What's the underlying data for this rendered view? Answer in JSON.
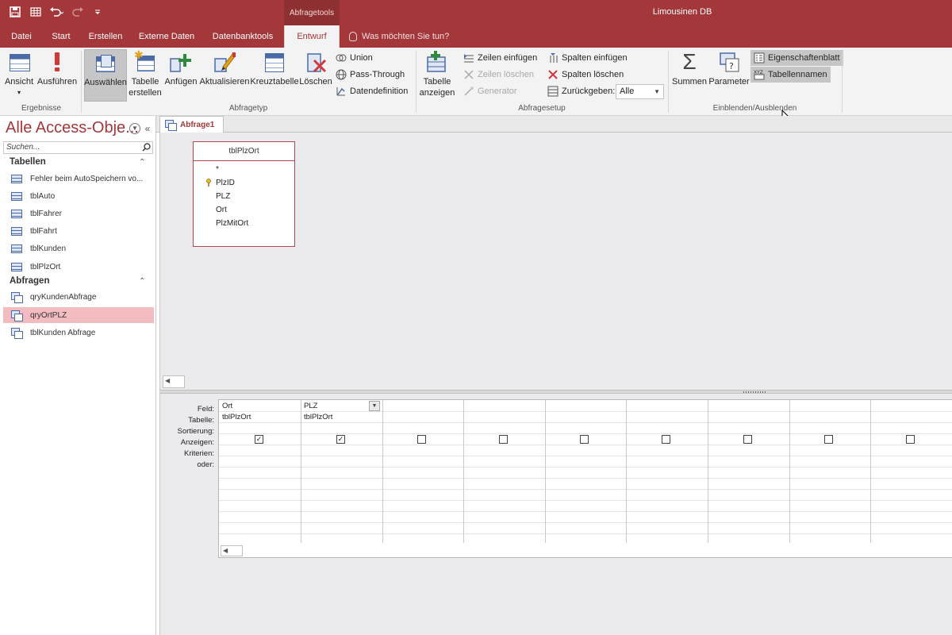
{
  "app": {
    "title": "Limousinen DB",
    "context_tab_group": "Abfragetools"
  },
  "ribbon_tabs": [
    {
      "label": "Datei"
    },
    {
      "label": "Start"
    },
    {
      "label": "Erstellen"
    },
    {
      "label": "Externe Daten"
    },
    {
      "label": "Datenbanktools"
    },
    {
      "label": "Entwurf",
      "active": true
    }
  ],
  "tell_me": "Was möchten Sie tun?",
  "ribbon": {
    "groups": {
      "ergebnisse": "Ergebnisse",
      "abfragetyp": "Abfragetyp",
      "abfragesetup": "Abfragesetup",
      "einblenden": "Einblenden/Ausblenden"
    },
    "buttons": {
      "ansicht": "Ansicht",
      "ausfuehren": "Ausführen",
      "auswaehlen": "Auswählen",
      "tabelle_erstellen_1": "Tabelle",
      "tabelle_erstellen_2": "erstellen",
      "anfuegen": "Anfügen",
      "aktualisieren": "Aktualisieren",
      "kreuztabelle": "Kreuztabelle",
      "loeschen": "Löschen",
      "union": "Union",
      "pass_through": "Pass-Through",
      "datendefinition": "Datendefinition",
      "tabelle_anzeigen_1": "Tabelle",
      "tabelle_anzeigen_2": "anzeigen",
      "zeilen_einfuegen": "Zeilen einfügen",
      "zeilen_loeschen": "Zeilen löschen",
      "generator": "Generator",
      "spalten_einfuegen": "Spalten einfügen",
      "spalten_loeschen": "Spalten löschen",
      "zurueckgeben": "Zurückgeben:",
      "zurueckgeben_value": "Alle",
      "summen": "Summen",
      "parameter": "Parameter",
      "eigenschaftenblatt": "Eigenschaftenblatt",
      "tabellennamen": "Tabellennamen"
    }
  },
  "nav": {
    "title": "Alle Access-Obje...",
    "search_placeholder": "Suchen...",
    "sections": [
      {
        "label": "Tabellen",
        "items": [
          {
            "label": "Fehler beim AutoSpeichern vo..."
          },
          {
            "label": "tblAuto"
          },
          {
            "label": "tblFahrer"
          },
          {
            "label": "tblFahrt"
          },
          {
            "label": "tblKunden"
          },
          {
            "label": "tblPlzOrt"
          }
        ]
      },
      {
        "label": "Abfragen",
        "items": [
          {
            "label": "qryKundenAbfrage"
          },
          {
            "label": "qryOrtPLZ",
            "selected": true
          },
          {
            "label": "tblKunden Abfrage"
          }
        ]
      }
    ]
  },
  "document_tab": "Abfrage1",
  "design": {
    "table_box": {
      "name": "tblPlzOrt",
      "fields": [
        "*",
        "PlzID",
        "PLZ",
        "Ort",
        "PlzMitOrt"
      ],
      "primary_key": "PlzID"
    }
  },
  "qbe": {
    "row_labels": [
      "Feld:",
      "Tabelle:",
      "Sortierung:",
      "Anzeigen:",
      "Kriterien:",
      "oder:"
    ],
    "columns": [
      {
        "feld": "Ort",
        "tabelle": "tblPlzOrt",
        "anzeigen": true
      },
      {
        "feld": "PLZ",
        "tabelle": "tblPlzOrt",
        "anzeigen": true
      },
      {
        "feld": "",
        "tabelle": "",
        "anzeigen": false
      },
      {
        "feld": "",
        "tabelle": "",
        "anzeigen": false
      },
      {
        "feld": "",
        "tabelle": "",
        "anzeigen": false
      },
      {
        "feld": "",
        "tabelle": "",
        "anzeigen": false
      },
      {
        "feld": "",
        "tabelle": "",
        "anzeigen": false
      },
      {
        "feld": "",
        "tabelle": "",
        "anzeigen": false
      },
      {
        "feld": "",
        "tabelle": "",
        "anzeigen": false
      }
    ]
  },
  "colors": {
    "accent": "#a4373a",
    "selected_item": "#f2bcc0",
    "ribbon_bg": "#f3f3f3"
  }
}
